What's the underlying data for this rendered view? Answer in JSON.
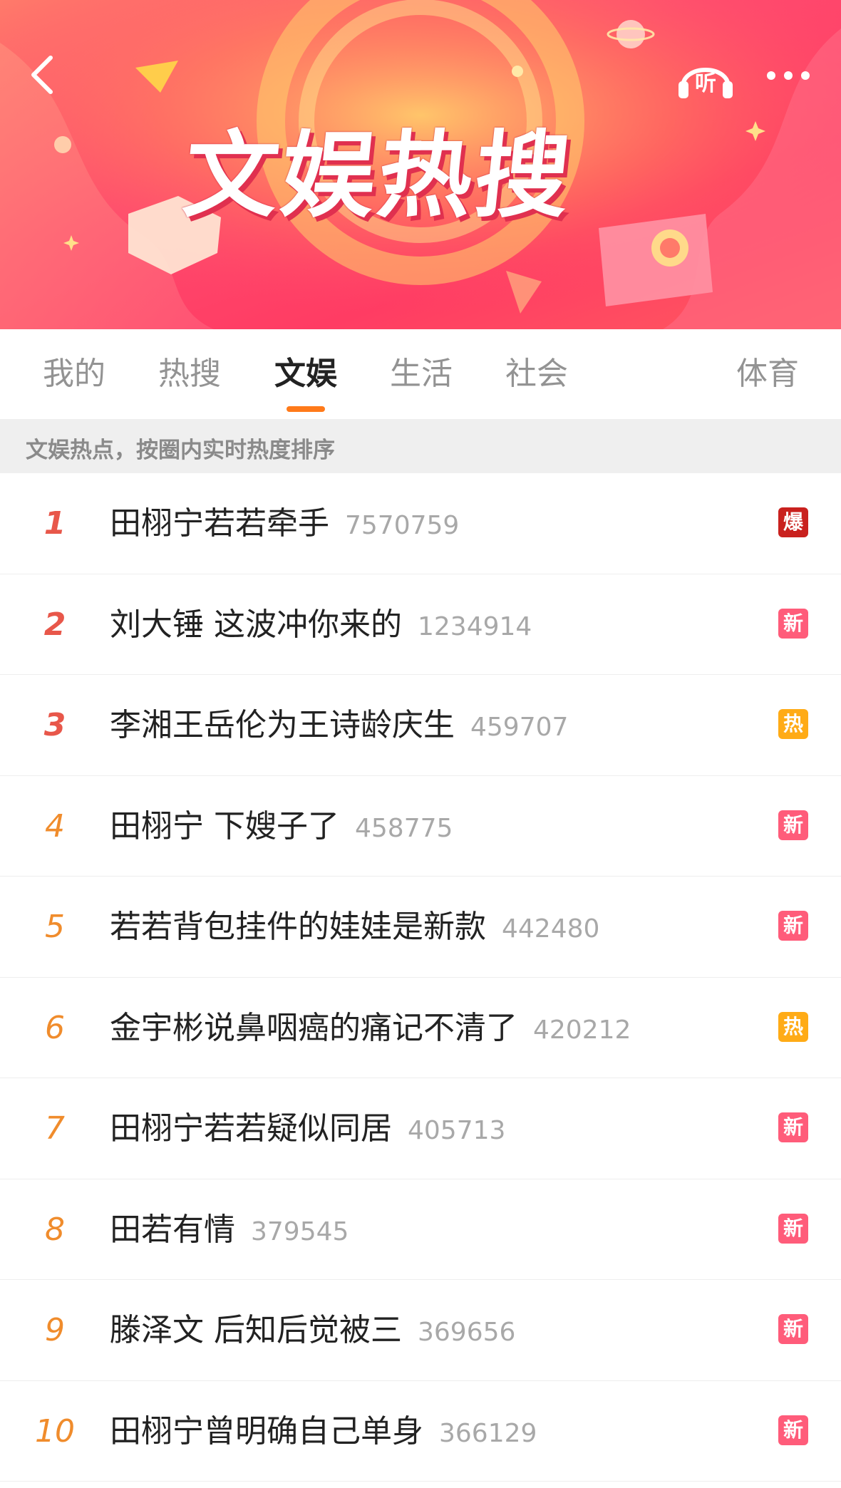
{
  "banner": {
    "title": "文娱热搜",
    "listen_label": "听"
  },
  "tabs": [
    {
      "label": "我的"
    },
    {
      "label": "热搜"
    },
    {
      "label": "文娱",
      "active": true
    },
    {
      "label": "生活"
    },
    {
      "label": "社会"
    },
    {
      "label": "体育"
    }
  ],
  "subheader": "文娱热点，按圈内实时热度排序",
  "badge_colors": {
    "爆": "#c9211e",
    "新": "#ff5c7a",
    "热": "#ffab16"
  },
  "colors": {
    "rank_top": "#e8574a",
    "rank_other": "#f08c2c",
    "tab_indicator": "#ff7a1a"
  },
  "items": [
    {
      "rank": "1",
      "title": "田栩宁若若牵手",
      "count": "7570759",
      "badge": "爆"
    },
    {
      "rank": "2",
      "title": "刘大锤 这波冲你来的",
      "count": "1234914",
      "badge": "新"
    },
    {
      "rank": "3",
      "title": "李湘王岳伦为王诗龄庆生",
      "count": "459707",
      "badge": "热"
    },
    {
      "rank": "4",
      "title": "田栩宁 下嫂子了",
      "count": "458775",
      "badge": "新"
    },
    {
      "rank": "5",
      "title": "若若背包挂件的娃娃是新款",
      "count": "442480",
      "badge": "新"
    },
    {
      "rank": "6",
      "title": "金宇彬说鼻咽癌的痛记不清了",
      "count": "420212",
      "badge": "热"
    },
    {
      "rank": "7",
      "title": "田栩宁若若疑似同居",
      "count": "405713",
      "badge": "新"
    },
    {
      "rank": "8",
      "title": "田若有情",
      "count": "379545",
      "badge": "新"
    },
    {
      "rank": "9",
      "title": "滕泽文 后知后觉被三",
      "count": "369656",
      "badge": "新"
    },
    {
      "rank": "10",
      "title": "田栩宁曾明确自己单身",
      "count": "366129",
      "badge": "新"
    }
  ]
}
